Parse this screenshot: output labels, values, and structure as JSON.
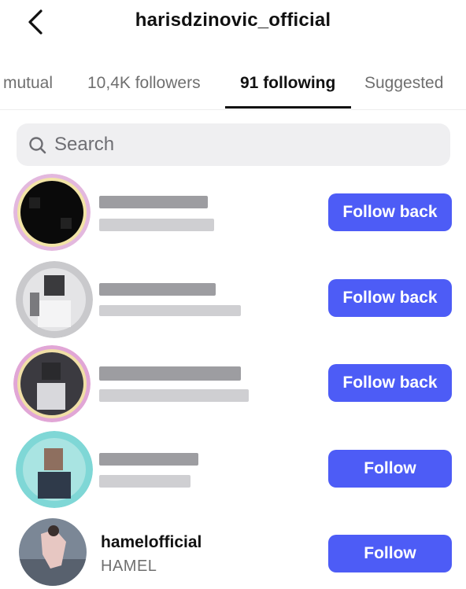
{
  "header": {
    "title": "harisdzinovic_official",
    "back_icon": "chevron-left-icon"
  },
  "tabs": [
    {
      "label": "mutual",
      "active": false
    },
    {
      "label": "10,4K followers",
      "active": false
    },
    {
      "label": "91 following",
      "active": true
    },
    {
      "label": "Suggested",
      "active": false
    }
  ],
  "search": {
    "placeholder": "Search",
    "value": "",
    "icon": "search-icon"
  },
  "accounts": [
    {
      "username": "",
      "name": "",
      "button": "Follow back",
      "redacted": true
    },
    {
      "username": "",
      "name": "",
      "button": "Follow back",
      "redacted": true
    },
    {
      "username": "",
      "name": "",
      "button": "Follow back",
      "redacted": true
    },
    {
      "username": "",
      "name": "",
      "button": "Follow",
      "redacted": true
    },
    {
      "username": "hamelofficial",
      "name": "HAMEL",
      "button": "Follow",
      "redacted": false
    }
  ],
  "colors": {
    "button": "#4d5cf6",
    "button_text": "#ffffff",
    "search_bg": "#efeff1",
    "muted_text": "#6f6f6f"
  }
}
